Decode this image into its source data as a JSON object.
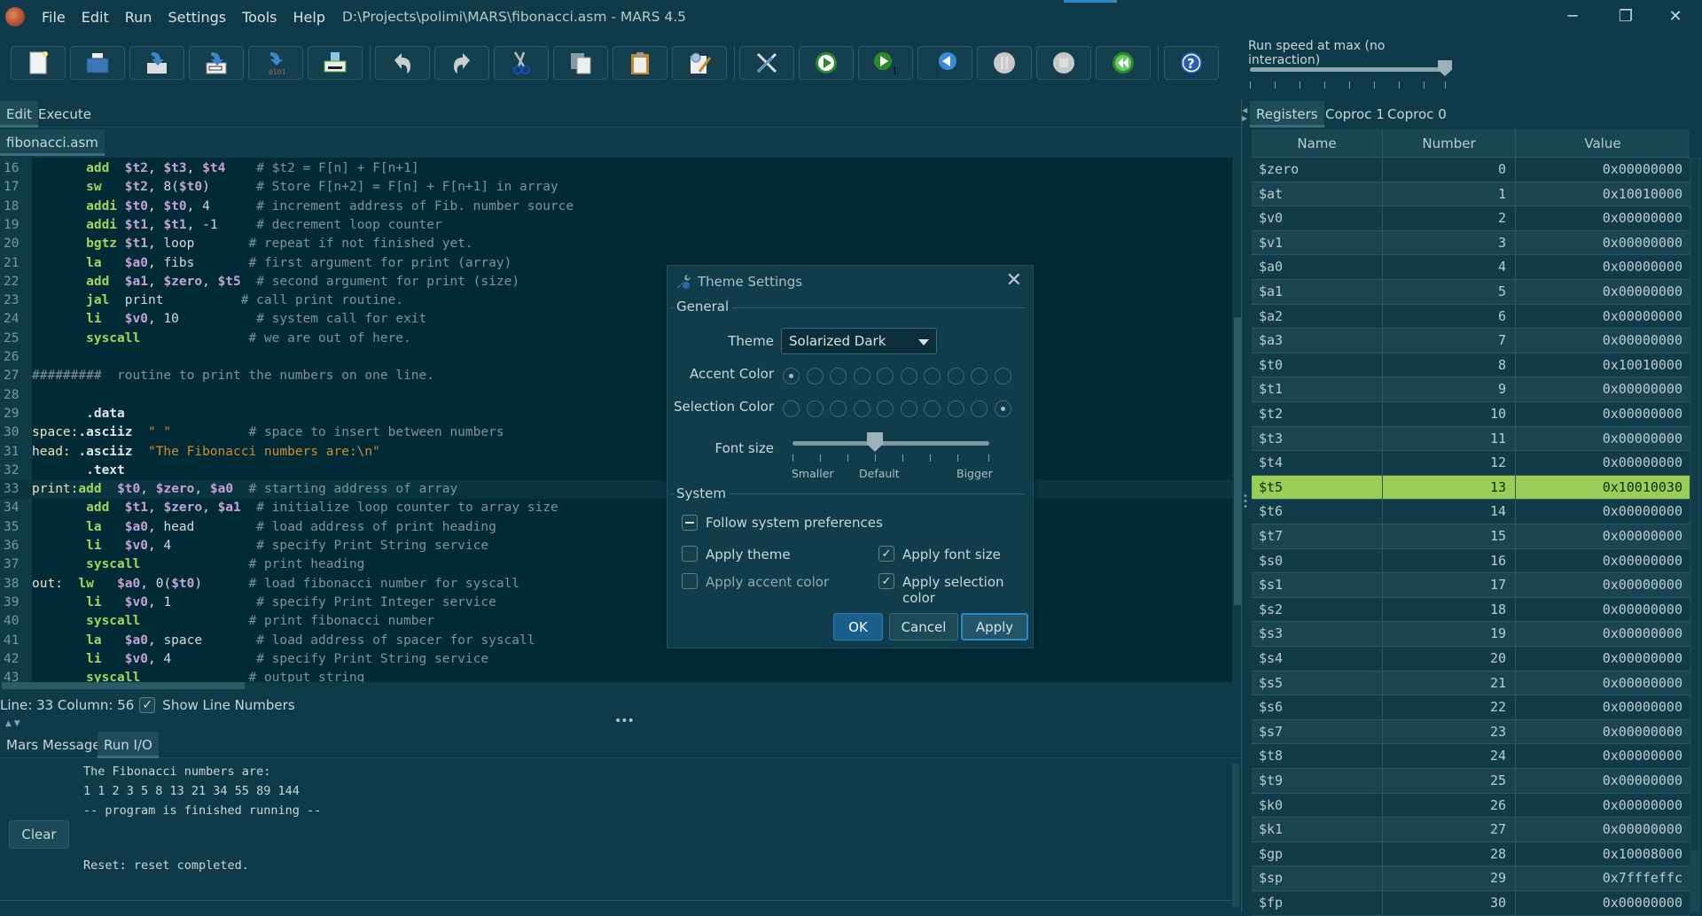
{
  "titlebar": {
    "menus": [
      "File",
      "Edit",
      "Run",
      "Settings",
      "Tools",
      "Help"
    ],
    "title": "D:\\Projects\\polimi\\MARS\\fibonacci.asm - MARS 4.5",
    "controls": {
      "minimize": "─",
      "maximize": "❐",
      "close": "✕"
    }
  },
  "toolbar": {
    "buttons": [
      {
        "name": "new-file",
        "icon": "new-file-icon"
      },
      {
        "name": "open",
        "icon": "open-folder-icon"
      },
      {
        "name": "save",
        "icon": "save-icon"
      },
      {
        "name": "save-as",
        "icon": "save-as-icon"
      },
      {
        "name": "dump-memory",
        "icon": "dump-memory-icon"
      },
      {
        "name": "print",
        "icon": "printer-icon"
      },
      {
        "name": "undo",
        "icon": "undo-icon"
      },
      {
        "name": "redo",
        "icon": "redo-icon"
      },
      {
        "name": "cut",
        "icon": "scissors-icon"
      },
      {
        "name": "copy",
        "icon": "copy-icon"
      },
      {
        "name": "paste",
        "icon": "clipboard-icon"
      },
      {
        "name": "find-replace",
        "icon": "find-replace-icon"
      },
      {
        "name": "assemble",
        "icon": "wrench-screwdriver-icon"
      },
      {
        "name": "run",
        "icon": "play-icon"
      },
      {
        "name": "step",
        "icon": "step-forward-icon"
      },
      {
        "name": "backstep",
        "icon": "step-back-icon"
      },
      {
        "name": "pause",
        "icon": "pause-icon"
      },
      {
        "name": "stop",
        "icon": "stop-icon"
      },
      {
        "name": "reset",
        "icon": "rewind-icon"
      },
      {
        "name": "help",
        "icon": "help-icon"
      }
    ],
    "speed_label": "Run speed at max (no interaction)",
    "speed_fraction": 1.0
  },
  "edit_tabs": [
    "Edit",
    "Execute"
  ],
  "active_edit_tab": "Edit",
  "file_tab": "fibonacci.asm",
  "editor": {
    "current_line": 33,
    "lines": [
      {
        "n": "16",
        "parts": [
          [
            "pl",
            "       "
          ],
          [
            "kw",
            "add"
          ],
          [
            "pl",
            "  "
          ],
          [
            "reg",
            "$t2"
          ],
          [
            "pl",
            ", "
          ],
          [
            "reg",
            "$t3"
          ],
          [
            "pl",
            ", "
          ],
          [
            "reg",
            "$t4"
          ],
          [
            "pl",
            "    "
          ],
          [
            "cm",
            "# $t2 = F[n] + F[n+1]"
          ]
        ]
      },
      {
        "n": "17",
        "parts": [
          [
            "pl",
            "       "
          ],
          [
            "kw",
            "sw"
          ],
          [
            "pl",
            "   "
          ],
          [
            "reg",
            "$t2"
          ],
          [
            "pl",
            ", 8("
          ],
          [
            "reg",
            "$t0"
          ],
          [
            "pl",
            ")      "
          ],
          [
            "cm",
            "# Store F[n+2] = F[n] + F[n+1] in array"
          ]
        ]
      },
      {
        "n": "18",
        "parts": [
          [
            "pl",
            "       "
          ],
          [
            "kw",
            "addi"
          ],
          [
            "pl",
            " "
          ],
          [
            "reg",
            "$t0"
          ],
          [
            "pl",
            ", "
          ],
          [
            "reg",
            "$t0"
          ],
          [
            "pl",
            ", 4      "
          ],
          [
            "cm",
            "# increment address of Fib. number source"
          ]
        ]
      },
      {
        "n": "19",
        "parts": [
          [
            "pl",
            "       "
          ],
          [
            "kw",
            "addi"
          ],
          [
            "pl",
            " "
          ],
          [
            "reg",
            "$t1"
          ],
          [
            "pl",
            ", "
          ],
          [
            "reg",
            "$t1"
          ],
          [
            "pl",
            ", -1     "
          ],
          [
            "cm",
            "# decrement loop counter"
          ]
        ]
      },
      {
        "n": "20",
        "parts": [
          [
            "pl",
            "       "
          ],
          [
            "kw",
            "bgtz"
          ],
          [
            "pl",
            " "
          ],
          [
            "reg",
            "$t1"
          ],
          [
            "pl",
            ", loop       "
          ],
          [
            "cm",
            "# repeat if not finished yet."
          ]
        ]
      },
      {
        "n": "21",
        "parts": [
          [
            "pl",
            "       "
          ],
          [
            "kw",
            "la"
          ],
          [
            "pl",
            "   "
          ],
          [
            "reg",
            "$a0"
          ],
          [
            "pl",
            ", fibs       "
          ],
          [
            "cm",
            "# first argument for print (array)"
          ]
        ]
      },
      {
        "n": "22",
        "parts": [
          [
            "pl",
            "       "
          ],
          [
            "kw",
            "add"
          ],
          [
            "pl",
            "  "
          ],
          [
            "reg",
            "$a1"
          ],
          [
            "pl",
            ", "
          ],
          [
            "reg",
            "$zero"
          ],
          [
            "pl",
            ", "
          ],
          [
            "reg",
            "$t5"
          ],
          [
            "pl",
            "  "
          ],
          [
            "cm",
            "# second argument for print (size)"
          ]
        ]
      },
      {
        "n": "23",
        "parts": [
          [
            "pl",
            "       "
          ],
          [
            "kw",
            "jal"
          ],
          [
            "pl",
            "  print          "
          ],
          [
            "cm",
            "# call print routine."
          ]
        ]
      },
      {
        "n": "24",
        "parts": [
          [
            "pl",
            "       "
          ],
          [
            "kw",
            "li"
          ],
          [
            "pl",
            "   "
          ],
          [
            "reg",
            "$v0"
          ],
          [
            "pl",
            ", 10          "
          ],
          [
            "cm",
            "# system call for exit"
          ]
        ]
      },
      {
        "n": "25",
        "parts": [
          [
            "pl",
            "       "
          ],
          [
            "kw",
            "syscall"
          ],
          [
            "pl",
            "              "
          ],
          [
            "cm",
            "# we are out of here."
          ]
        ]
      },
      {
        "n": "26",
        "parts": []
      },
      {
        "n": "27",
        "parts": [
          [
            "cm",
            "#########  routine to print the numbers on one line."
          ]
        ]
      },
      {
        "n": "28",
        "parts": []
      },
      {
        "n": "29",
        "parts": [
          [
            "pl",
            "       "
          ],
          [
            "dir",
            ".data"
          ]
        ]
      },
      {
        "n": "30",
        "parts": [
          [
            "lbl",
            "space:"
          ],
          [
            "dir",
            ".asciiz"
          ],
          [
            "pl",
            "  "
          ],
          [
            "str",
            "\" \""
          ],
          [
            "pl",
            "          "
          ],
          [
            "cm",
            "# space to insert between numbers"
          ]
        ]
      },
      {
        "n": "31",
        "parts": [
          [
            "lbl",
            "head: "
          ],
          [
            "dir",
            ".asciiz"
          ],
          [
            "pl",
            "  "
          ],
          [
            "str",
            "\"The Fibonacci numbers are:\\n\""
          ]
        ]
      },
      {
        "n": "32",
        "parts": [
          [
            "pl",
            "       "
          ],
          [
            "dir",
            ".text"
          ]
        ]
      },
      {
        "n": "33",
        "parts": [
          [
            "lbl",
            "print:"
          ],
          [
            "kw",
            "add"
          ],
          [
            "pl",
            "  "
          ],
          [
            "reg",
            "$t0"
          ],
          [
            "pl",
            ", "
          ],
          [
            "reg",
            "$zero"
          ],
          [
            "pl",
            ", "
          ],
          [
            "reg",
            "$a0"
          ],
          [
            "pl",
            "  "
          ],
          [
            "cm",
            "# starting address of array"
          ]
        ]
      },
      {
        "n": "34",
        "parts": [
          [
            "pl",
            "       "
          ],
          [
            "kw",
            "add"
          ],
          [
            "pl",
            "  "
          ],
          [
            "reg",
            "$t1"
          ],
          [
            "pl",
            ", "
          ],
          [
            "reg",
            "$zero"
          ],
          [
            "pl",
            ", "
          ],
          [
            "reg",
            "$a1"
          ],
          [
            "pl",
            "  "
          ],
          [
            "cm",
            "# initialize loop counter to array size"
          ]
        ]
      },
      {
        "n": "35",
        "parts": [
          [
            "pl",
            "       "
          ],
          [
            "kw",
            "la"
          ],
          [
            "pl",
            "   "
          ],
          [
            "reg",
            "$a0"
          ],
          [
            "pl",
            ", head        "
          ],
          [
            "cm",
            "# load address of print heading"
          ]
        ]
      },
      {
        "n": "36",
        "parts": [
          [
            "pl",
            "       "
          ],
          [
            "kw",
            "li"
          ],
          [
            "pl",
            "   "
          ],
          [
            "reg",
            "$v0"
          ],
          [
            "pl",
            ", 4           "
          ],
          [
            "cm",
            "# specify Print String service"
          ]
        ]
      },
      {
        "n": "37",
        "parts": [
          [
            "pl",
            "       "
          ],
          [
            "kw",
            "syscall"
          ],
          [
            "pl",
            "              "
          ],
          [
            "cm",
            "# print heading"
          ]
        ]
      },
      {
        "n": "38",
        "parts": [
          [
            "lbl",
            "out:  "
          ],
          [
            "kw",
            "lw"
          ],
          [
            "pl",
            "   "
          ],
          [
            "reg",
            "$a0"
          ],
          [
            "pl",
            ", 0("
          ],
          [
            "reg",
            "$t0"
          ],
          [
            "pl",
            ")      "
          ],
          [
            "cm",
            "# load fibonacci number for syscall"
          ]
        ]
      },
      {
        "n": "39",
        "parts": [
          [
            "pl",
            "       "
          ],
          [
            "kw",
            "li"
          ],
          [
            "pl",
            "   "
          ],
          [
            "reg",
            "$v0"
          ],
          [
            "pl",
            ", 1           "
          ],
          [
            "cm",
            "# specify Print Integer service"
          ]
        ]
      },
      {
        "n": "40",
        "parts": [
          [
            "pl",
            "       "
          ],
          [
            "kw",
            "syscall"
          ],
          [
            "pl",
            "              "
          ],
          [
            "cm",
            "# print fibonacci number"
          ]
        ]
      },
      {
        "n": "41",
        "parts": [
          [
            "pl",
            "       "
          ],
          [
            "kw",
            "la"
          ],
          [
            "pl",
            "   "
          ],
          [
            "reg",
            "$a0"
          ],
          [
            "pl",
            ", space       "
          ],
          [
            "cm",
            "# load address of spacer for syscall"
          ]
        ]
      },
      {
        "n": "42",
        "parts": [
          [
            "pl",
            "       "
          ],
          [
            "kw",
            "li"
          ],
          [
            "pl",
            "   "
          ],
          [
            "reg",
            "$v0"
          ],
          [
            "pl",
            ", 4           "
          ],
          [
            "cm",
            "# specify Print String service"
          ]
        ]
      },
      {
        "n": "43",
        "parts": [
          [
            "pl",
            "       "
          ],
          [
            "kw",
            "syscall"
          ],
          [
            "pl",
            "              "
          ],
          [
            "cm",
            "# output string"
          ]
        ]
      }
    ]
  },
  "status": {
    "position": "Line: 33 Column: 56",
    "show_line_numbers_label": "Show Line Numbers",
    "show_line_numbers": true
  },
  "messages": {
    "tabs": [
      "Mars Messages",
      "Run I/O"
    ],
    "active_tab": "Run I/O",
    "output": [
      "The Fibonacci numbers are:",
      "1 1 2 3 5 8 13 21 34 55 89 144",
      "-- program is finished running --",
      "",
      "Reset: reset completed."
    ],
    "clear_label": "Clear"
  },
  "registers": {
    "tabs": [
      "Registers",
      "Coproc 1",
      "Coproc 0"
    ],
    "active_tab": "Registers",
    "columns": [
      "Name",
      "Number",
      "Value"
    ],
    "highlighted": "$t5",
    "rows": [
      [
        "$zero",
        "0",
        "0x00000000"
      ],
      [
        "$at",
        "1",
        "0x10010000"
      ],
      [
        "$v0",
        "2",
        "0x00000000"
      ],
      [
        "$v1",
        "3",
        "0x00000000"
      ],
      [
        "$a0",
        "4",
        "0x00000000"
      ],
      [
        "$a1",
        "5",
        "0x00000000"
      ],
      [
        "$a2",
        "6",
        "0x00000000"
      ],
      [
        "$a3",
        "7",
        "0x00000000"
      ],
      [
        "$t0",
        "8",
        "0x10010000"
      ],
      [
        "$t1",
        "9",
        "0x00000000"
      ],
      [
        "$t2",
        "10",
        "0x00000000"
      ],
      [
        "$t3",
        "11",
        "0x00000000"
      ],
      [
        "$t4",
        "12",
        "0x00000000"
      ],
      [
        "$t5",
        "13",
        "0x10010030"
      ],
      [
        "$t6",
        "14",
        "0x00000000"
      ],
      [
        "$t7",
        "15",
        "0x00000000"
      ],
      [
        "$s0",
        "16",
        "0x00000000"
      ],
      [
        "$s1",
        "17",
        "0x00000000"
      ],
      [
        "$s2",
        "18",
        "0x00000000"
      ],
      [
        "$s3",
        "19",
        "0x00000000"
      ],
      [
        "$s4",
        "20",
        "0x00000000"
      ],
      [
        "$s5",
        "21",
        "0x00000000"
      ],
      [
        "$s6",
        "22",
        "0x00000000"
      ],
      [
        "$s7",
        "23",
        "0x00000000"
      ],
      [
        "$t8",
        "24",
        "0x00000000"
      ],
      [
        "$t9",
        "25",
        "0x00000000"
      ],
      [
        "$k0",
        "26",
        "0x00000000"
      ],
      [
        "$k1",
        "27",
        "0x00000000"
      ],
      [
        "$gp",
        "28",
        "0x10008000"
      ],
      [
        "$sp",
        "29",
        "0x7fffeffc"
      ],
      [
        "$fp",
        "30",
        "0x00000000"
      ]
    ]
  },
  "dialog": {
    "title": "Theme Settings",
    "close": "✕",
    "general_label": "General",
    "theme_label": "Theme",
    "theme_value": "Solarized Dark",
    "accent_label": "Accent Color",
    "accent_selected_index": 0,
    "selection_label": "Selection Color",
    "selection_selected_index": 9,
    "swatch_count": 10,
    "font_size_label": "Font size",
    "font_size_ticks": [
      "Smaller",
      "Default",
      "Bigger"
    ],
    "font_size_position": "Default",
    "system_label": "System",
    "follow_system": {
      "label": "Follow system preferences",
      "state": "indeterminate"
    },
    "apply_theme": {
      "label": "Apply theme",
      "checked": false
    },
    "apply_font_size": {
      "label": "Apply font size",
      "checked": true
    },
    "apply_accent": {
      "label": "Apply accent color",
      "checked": false
    },
    "apply_selection": {
      "label": "Apply selection color",
      "checked": true
    },
    "buttons": {
      "ok": "OK",
      "cancel": "Cancel",
      "apply": "Apply"
    }
  }
}
